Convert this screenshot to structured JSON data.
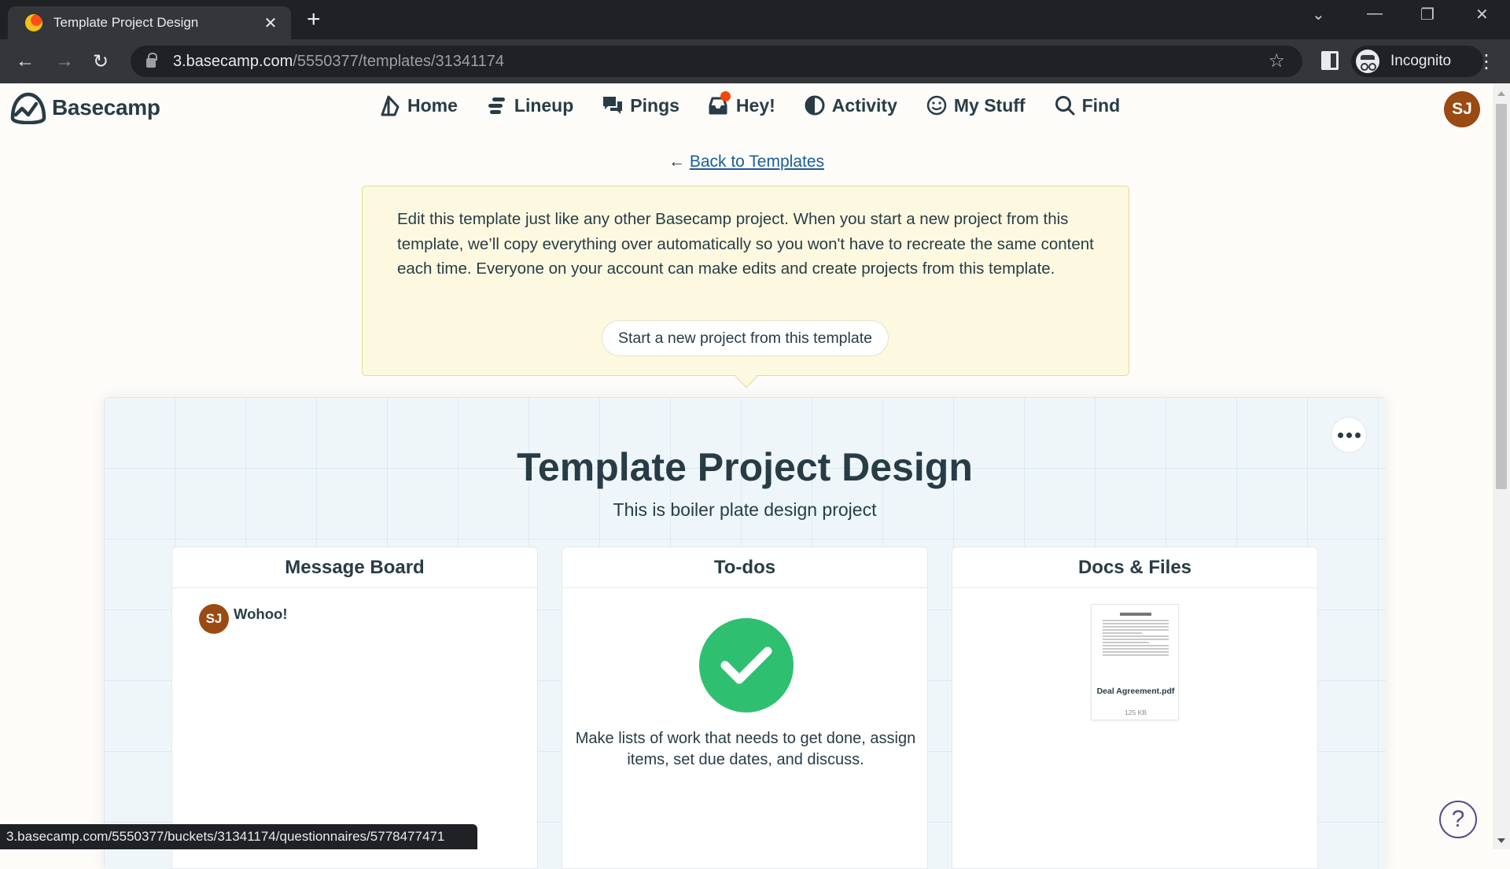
{
  "browser": {
    "tab_title": "Template Project Design",
    "tab_close": "✕",
    "new_tab": "+",
    "window_controls": {
      "dropdown": "⌄",
      "minimize": "—",
      "restore": "❐",
      "close": "✕"
    },
    "url_host": "3.basecamp.com",
    "url_path": "/5550377/templates/31341174",
    "back": "←",
    "forward": "→",
    "reload": "↻",
    "bookmark": "☆",
    "profile_label": "Incognito",
    "menu": "⋮"
  },
  "header": {
    "logo_text": "Basecamp",
    "nav": [
      {
        "label": "Home",
        "icon": "home-icon"
      },
      {
        "label": "Lineup",
        "icon": "lineup-icon"
      },
      {
        "label": "Pings",
        "icon": "pings-icon"
      },
      {
        "label": "Hey!",
        "icon": "hey-inbox-icon",
        "has_notification": true
      },
      {
        "label": "Activity",
        "icon": "activity-icon"
      },
      {
        "label": "My Stuff",
        "icon": "my-stuff-icon"
      },
      {
        "label": "Find",
        "icon": "search-icon"
      }
    ],
    "avatar_initials": "SJ",
    "avatar_color": "#9a4a12",
    "notification_color": "#f2470b"
  },
  "back_link": {
    "arrow": "←",
    "label": "Back to Templates"
  },
  "notice": {
    "text": "Edit this template just like any other Basecamp project. When you start a new project from this template, we’ll copy everything over automatically so you won't have to recreate the same content each time. Everyone on your account can make edits and create projects from this template.",
    "button_label": "Start a new project from this template"
  },
  "project": {
    "title": "Template Project Design",
    "description": "This is boiler plate design project",
    "tools": [
      {
        "name": "Message Board",
        "messages": [
          {
            "author_initials": "SJ",
            "title": "Wohoo!"
          }
        ]
      },
      {
        "name": "To-dos",
        "empty_text": "Make lists of work that needs to get done, assign items, set due dates, and discuss.",
        "accent_color": "#2fbf71"
      },
      {
        "name": "Docs & Files",
        "files": [
          {
            "name": "Deal Agreement.pdf",
            "size": "125 KB"
          }
        ]
      }
    ]
  },
  "status_bar_url": "3.basecamp.com/5550377/buckets/31341174/questionnaires/5778477471",
  "help_label": "?"
}
